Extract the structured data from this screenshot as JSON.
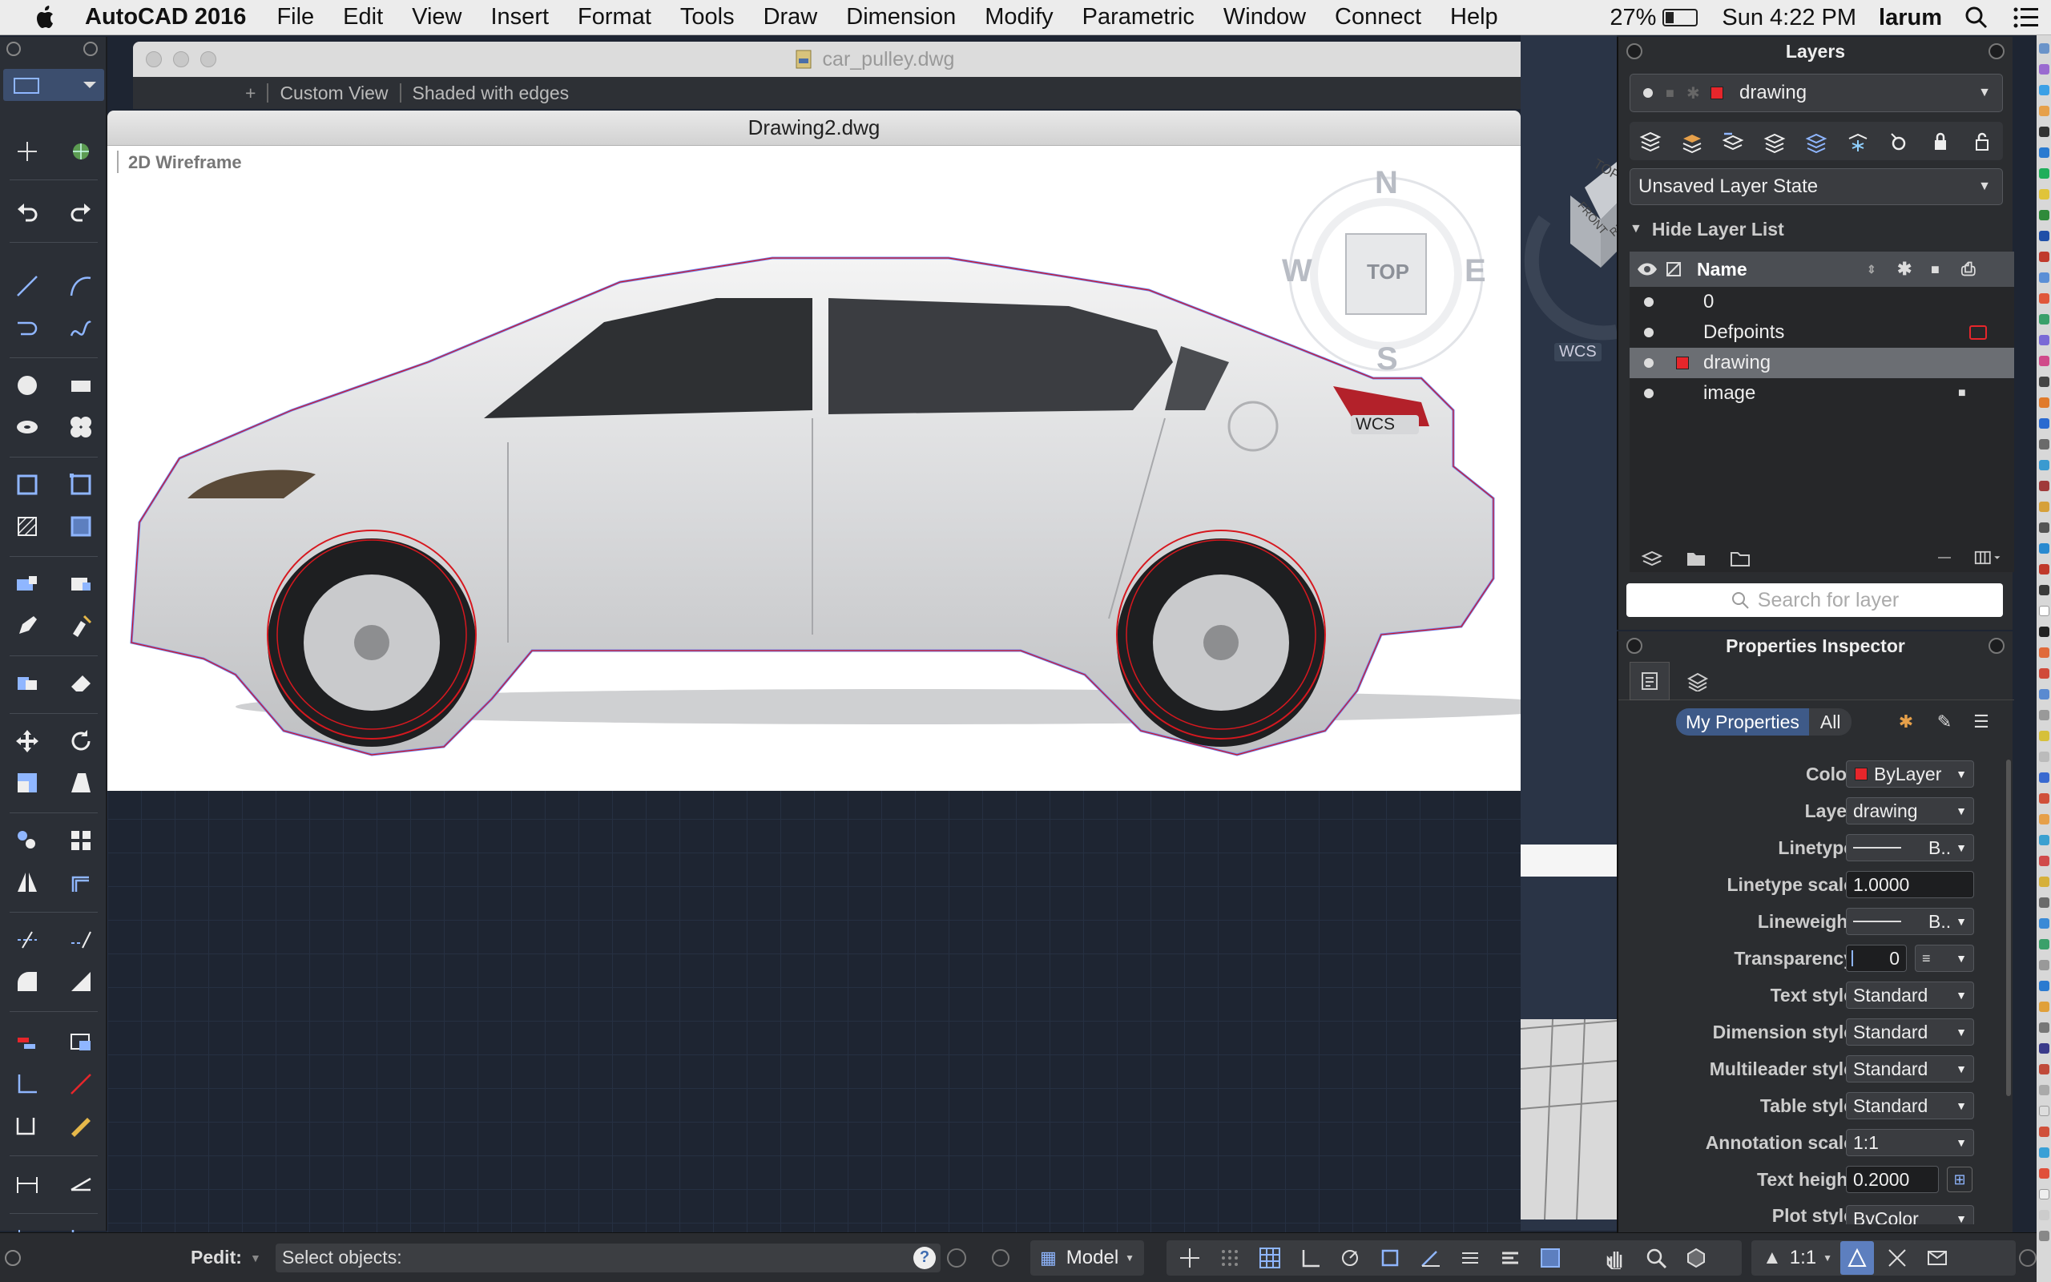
{
  "menubar": {
    "app_name": "AutoCAD 2016",
    "menus": [
      "File",
      "Edit",
      "View",
      "Insert",
      "Format",
      "Tools",
      "Draw",
      "Dimension",
      "Modify",
      "Parametric",
      "Window",
      "Connect",
      "Help"
    ],
    "battery": "27%",
    "clock": "Sun 4:22 PM",
    "user": "larum"
  },
  "bg_window": {
    "title": "car_pulley.dwg",
    "view_label": "Custom View",
    "visual_style": "Shaded with edges"
  },
  "main_window": {
    "title": "Drawing2.dwg",
    "visual_style": "2D Wireframe"
  },
  "viewcube": {
    "north": "N",
    "south": "S",
    "east": "E",
    "west": "W",
    "face": "TOP",
    "ucs": "WCS"
  },
  "canvas_ucs": "WCS",
  "right_view": {
    "ucs": "WCS",
    "cube_top": "TOP",
    "cube_front": "FRONT",
    "cube_right": "RIG"
  },
  "layers_panel": {
    "title": "Layers",
    "current_layer": "drawing",
    "layer_state": "Unsaved Layer State",
    "hide_list": "Hide Layer List",
    "column_name": "Name",
    "layers": [
      {
        "name": "0"
      },
      {
        "name": "Defpoints"
      },
      {
        "name": "drawing"
      },
      {
        "name": "image"
      }
    ],
    "search_placeholder": "Search for layer"
  },
  "properties": {
    "title": "Properties Inspector",
    "tab_mine": "My Properties",
    "tab_all": "All",
    "rows": [
      {
        "label": "Color",
        "value": "ByLayer"
      },
      {
        "label": "Layer",
        "value": "drawing"
      },
      {
        "label": "Linetype",
        "value": "B.."
      },
      {
        "label": "Linetype scale",
        "value": "1.0000"
      },
      {
        "label": "Lineweight",
        "value": "B.."
      },
      {
        "label": "Transparency",
        "value": "0"
      },
      {
        "label": "Text style",
        "value": "Standard"
      },
      {
        "label": "Dimension style",
        "value": "Standard"
      },
      {
        "label": "Multileader style",
        "value": "Standard"
      },
      {
        "label": "Table style",
        "value": "Standard"
      },
      {
        "label": "Annotation scale",
        "value": "1:1"
      },
      {
        "label": "Text height",
        "value": "0.2000"
      },
      {
        "label": "Plot style",
        "value": "ByColor"
      }
    ]
  },
  "command_line": {
    "prompt": "Pedit:",
    "text": "Select objects:"
  },
  "status_bar": {
    "space": "Model",
    "scale": "1:1"
  },
  "colors": {
    "accent_red": "#e6262b",
    "selection_blue": "#6a7cf0",
    "circle_red": "#d6181f"
  }
}
